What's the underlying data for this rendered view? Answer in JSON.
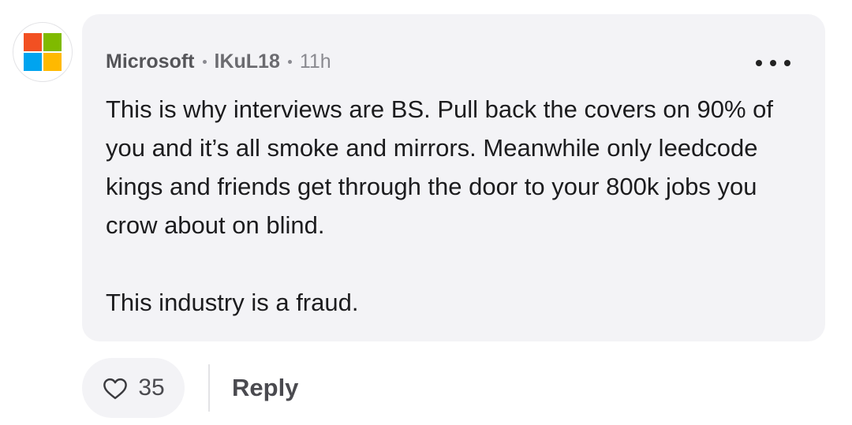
{
  "comment": {
    "author": {
      "company": "Microsoft",
      "username": "lKuL18",
      "time_ago": "11h",
      "avatar_icon": "microsoft-logo-icon",
      "logo_colors": [
        "#f25022",
        "#7fba00",
        "#00a4ef",
        "#ffb900"
      ]
    },
    "more_icon": "more-horizontal-icon",
    "paragraphs": [
      "This is why interviews are BS.  Pull back the covers on 90% of you and it’s all smoke and mirrors.  Meanwhile only leedcode kings and friends get through the door to your 800k jobs you crow about on blind.",
      "This industry is a fraud."
    ]
  },
  "actions": {
    "like_icon": "heart-icon",
    "like_count": "35",
    "reply_label": "Reply"
  },
  "colors": {
    "bubble_bg": "#f3f3f6",
    "text": "#1c1c1e",
    "meta_text": "#6b6b70"
  }
}
